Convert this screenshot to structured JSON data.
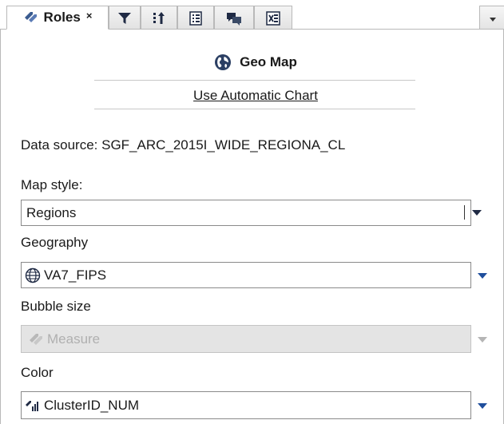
{
  "tabs": {
    "roles_label": "Roles",
    "close_glyph": "×",
    "icons": [
      "roles-icon",
      "filter-icon",
      "sort-icon",
      "properties-icon",
      "comments-icon",
      "export-icon"
    ],
    "menu_icon": "chevron-down-icon"
  },
  "chart": {
    "title": "Geo Map",
    "auto_link": "Use Automatic Chart"
  },
  "data_source": {
    "text": "Data source:  SGF_ARC_2015I_WIDE_REGIONA_CL"
  },
  "map_style": {
    "label": "Map style:",
    "value": "Regions"
  },
  "geography": {
    "label": "Geography",
    "value": "VA7_FIPS",
    "icon": "geography-icon"
  },
  "bubble_size": {
    "label": "Bubble size",
    "placeholder": "Measure",
    "icon": "measure-icon",
    "enabled": false
  },
  "color": {
    "label": "Color",
    "value": "ClusterID_NUM",
    "icon": "category-icon"
  },
  "colors": {
    "accent_arrow": "#1f4e9c",
    "border": "#b9b9b9",
    "disabled_bg": "#e4e4e4"
  }
}
